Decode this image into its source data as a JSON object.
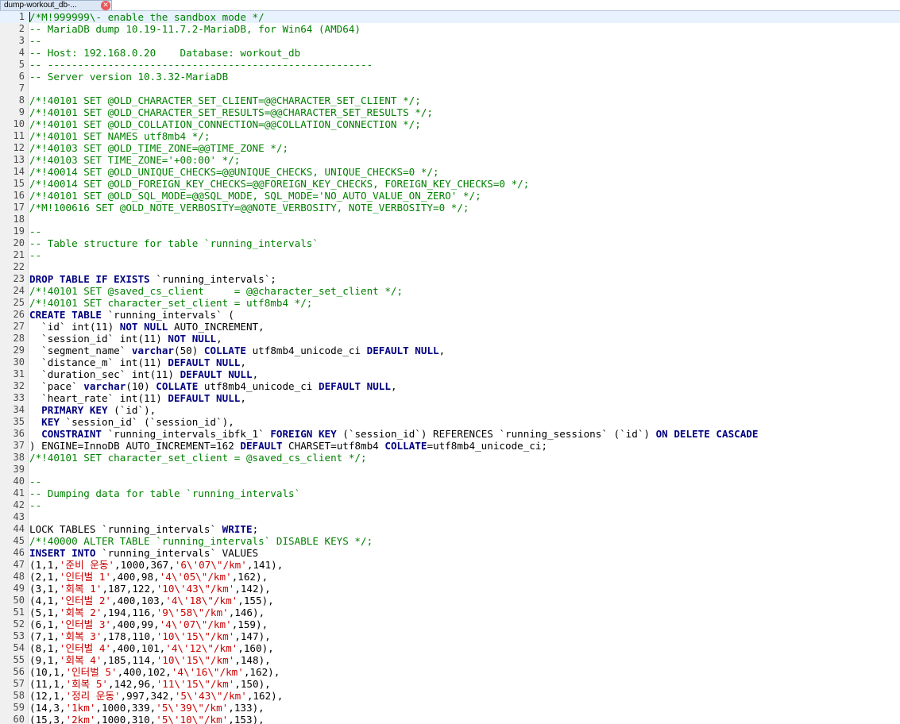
{
  "tab": {
    "title": "dump-workout_db-...",
    "close_icon": "close-icon"
  },
  "colors": {
    "comment": "#008000",
    "keyword": "#000080",
    "string": "#c80000"
  },
  "lines": [
    {
      "n": "1",
      "t": [
        [
          "c",
          "/*M!999999\\- enable the sandbox mode */"
        ]
      ]
    },
    {
      "n": "2",
      "t": [
        [
          "c",
          "-- MariaDB dump 10.19-11.7.2-MariaDB, for Win64 (AMD64)"
        ]
      ]
    },
    {
      "n": "3",
      "t": [
        [
          "c",
          "--"
        ]
      ]
    },
    {
      "n": "4",
      "t": [
        [
          "c",
          "-- Host: 192.168.0.20    Database: workout_db"
        ]
      ]
    },
    {
      "n": "5",
      "t": [
        [
          "c",
          "-- ------------------------------------------------------"
        ]
      ]
    },
    {
      "n": "6",
      "t": [
        [
          "c",
          "-- Server version 10.3.32-MariaDB"
        ]
      ]
    },
    {
      "n": "7",
      "t": []
    },
    {
      "n": "8",
      "t": [
        [
          "c",
          "/*!40101 SET @OLD_CHARACTER_SET_CLIENT=@@CHARACTER_SET_CLIENT */;"
        ]
      ]
    },
    {
      "n": "9",
      "t": [
        [
          "c",
          "/*!40101 SET @OLD_CHARACTER_SET_RESULTS=@@CHARACTER_SET_RESULTS */;"
        ]
      ]
    },
    {
      "n": "10",
      "t": [
        [
          "c",
          "/*!40101 SET @OLD_COLLATION_CONNECTION=@@COLLATION_CONNECTION */;"
        ]
      ]
    },
    {
      "n": "11",
      "t": [
        [
          "c",
          "/*!40101 SET NAMES utf8mb4 */;"
        ]
      ]
    },
    {
      "n": "12",
      "t": [
        [
          "c",
          "/*!40103 SET @OLD_TIME_ZONE=@@TIME_ZONE */;"
        ]
      ]
    },
    {
      "n": "13",
      "t": [
        [
          "c",
          "/*!40103 SET TIME_ZONE='+00:00' */;"
        ]
      ]
    },
    {
      "n": "14",
      "t": [
        [
          "c",
          "/*!40014 SET @OLD_UNIQUE_CHECKS=@@UNIQUE_CHECKS, UNIQUE_CHECKS=0 */;"
        ]
      ]
    },
    {
      "n": "15",
      "t": [
        [
          "c",
          "/*!40014 SET @OLD_FOREIGN_KEY_CHECKS=@@FOREIGN_KEY_CHECKS, FOREIGN_KEY_CHECKS=0 */;"
        ]
      ]
    },
    {
      "n": "16",
      "t": [
        [
          "c",
          "/*!40101 SET @OLD_SQL_MODE=@@SQL_MODE, SQL_MODE='NO_AUTO_VALUE_ON_ZERO' */;"
        ]
      ]
    },
    {
      "n": "17",
      "t": [
        [
          "c",
          "/*M!100616 SET @OLD_NOTE_VERBOSITY=@@NOTE_VERBOSITY, NOTE_VERBOSITY=0 */;"
        ]
      ]
    },
    {
      "n": "18",
      "t": []
    },
    {
      "n": "19",
      "t": [
        [
          "c",
          "--"
        ]
      ]
    },
    {
      "n": "20",
      "t": [
        [
          "c",
          "-- Table structure for table `running_intervals`"
        ]
      ]
    },
    {
      "n": "21",
      "t": [
        [
          "c",
          "--"
        ]
      ]
    },
    {
      "n": "22",
      "t": []
    },
    {
      "n": "23",
      "t": [
        [
          "k",
          "DROP TABLE IF EXISTS"
        ],
        [
          "p",
          " `running_intervals`;"
        ]
      ]
    },
    {
      "n": "24",
      "t": [
        [
          "c",
          "/*!40101 SET @saved_cs_client     = @@character_set_client */;"
        ]
      ]
    },
    {
      "n": "25",
      "t": [
        [
          "c",
          "/*!40101 SET character_set_client = utf8mb4 */;"
        ]
      ]
    },
    {
      "n": "26",
      "t": [
        [
          "k",
          "CREATE TABLE"
        ],
        [
          "p",
          " `running_intervals` ("
        ]
      ]
    },
    {
      "n": "27",
      "t": [
        [
          "p",
          "  `id` int(11) "
        ],
        [
          "k",
          "NOT NULL"
        ],
        [
          "p",
          " AUTO_INCREMENT,"
        ]
      ]
    },
    {
      "n": "28",
      "t": [
        [
          "p",
          "  `session_id` int(11) "
        ],
        [
          "k",
          "NOT NULL"
        ],
        [
          "p",
          ","
        ]
      ]
    },
    {
      "n": "29",
      "t": [
        [
          "p",
          "  `segment_name` "
        ],
        [
          "k",
          "varchar"
        ],
        [
          "p",
          "(50) "
        ],
        [
          "k",
          "COLLATE"
        ],
        [
          "p",
          " utf8mb4_unicode_ci "
        ],
        [
          "k",
          "DEFAULT NULL"
        ],
        [
          "p",
          ","
        ]
      ]
    },
    {
      "n": "30",
      "t": [
        [
          "p",
          "  `distance_m` int(11) "
        ],
        [
          "k",
          "DEFAULT NULL"
        ],
        [
          "p",
          ","
        ]
      ]
    },
    {
      "n": "31",
      "t": [
        [
          "p",
          "  `duration_sec` int(11) "
        ],
        [
          "k",
          "DEFAULT NULL"
        ],
        [
          "p",
          ","
        ]
      ]
    },
    {
      "n": "32",
      "t": [
        [
          "p",
          "  `pace` "
        ],
        [
          "k",
          "varchar"
        ],
        [
          "p",
          "(10) "
        ],
        [
          "k",
          "COLLATE"
        ],
        [
          "p",
          " utf8mb4_unicode_ci "
        ],
        [
          "k",
          "DEFAULT NULL"
        ],
        [
          "p",
          ","
        ]
      ]
    },
    {
      "n": "33",
      "t": [
        [
          "p",
          "  `heart_rate` int(11) "
        ],
        [
          "k",
          "DEFAULT NULL"
        ],
        [
          "p",
          ","
        ]
      ]
    },
    {
      "n": "34",
      "t": [
        [
          "p",
          "  "
        ],
        [
          "k",
          "PRIMARY KEY"
        ],
        [
          "p",
          " (`id`),"
        ]
      ]
    },
    {
      "n": "35",
      "t": [
        [
          "p",
          "  "
        ],
        [
          "k",
          "KEY"
        ],
        [
          "p",
          " `session_id` (`session_id`),"
        ]
      ]
    },
    {
      "n": "36",
      "t": [
        [
          "p",
          "  "
        ],
        [
          "k",
          "CONSTRAINT"
        ],
        [
          "p",
          " `running_intervals_ibfk_1` "
        ],
        [
          "k",
          "FOREIGN KEY"
        ],
        [
          "p",
          " (`session_id`) REFERENCES `running_sessions` (`id`) "
        ],
        [
          "k",
          "ON DELETE CASCADE"
        ]
      ]
    },
    {
      "n": "37",
      "t": [
        [
          "p",
          ") ENGINE=InnoDB AUTO_INCREMENT=162 "
        ],
        [
          "k",
          "DEFAULT"
        ],
        [
          "p",
          " CHARSET=utf8mb4 "
        ],
        [
          "k",
          "COLLATE"
        ],
        [
          "p",
          "=utf8mb4_unicode_ci;"
        ]
      ]
    },
    {
      "n": "38",
      "t": [
        [
          "c",
          "/*!40101 SET character_set_client = @saved_cs_client */;"
        ]
      ]
    },
    {
      "n": "39",
      "t": []
    },
    {
      "n": "40",
      "t": [
        [
          "c",
          "--"
        ]
      ]
    },
    {
      "n": "41",
      "t": [
        [
          "c",
          "-- Dumping data for table `running_intervals`"
        ]
      ]
    },
    {
      "n": "42",
      "t": [
        [
          "c",
          "--"
        ]
      ]
    },
    {
      "n": "43",
      "t": []
    },
    {
      "n": "44",
      "t": [
        [
          "p",
          "LOCK TABLES `running_intervals` "
        ],
        [
          "k",
          "WRITE"
        ],
        [
          "p",
          ";"
        ]
      ]
    },
    {
      "n": "45",
      "t": [
        [
          "c",
          "/*!40000 ALTER TABLE `running_intervals` DISABLE KEYS */;"
        ]
      ]
    },
    {
      "n": "46",
      "t": [
        [
          "k",
          "INSERT INTO"
        ],
        [
          "p",
          " `running_intervals` VALUES"
        ]
      ]
    },
    {
      "n": "47",
      "t": [
        [
          "p",
          "(1,1,"
        ],
        [
          "s",
          "'준비 운동'"
        ],
        [
          "p",
          ",1000,367,"
        ],
        [
          "s",
          "'6\\'07\\\"/km'"
        ],
        [
          "p",
          ",141),"
        ]
      ]
    },
    {
      "n": "48",
      "t": [
        [
          "p",
          "(2,1,"
        ],
        [
          "s",
          "'인터벌 1'"
        ],
        [
          "p",
          ",400,98,"
        ],
        [
          "s",
          "'4\\'05\\\"/km'"
        ],
        [
          "p",
          ",162),"
        ]
      ]
    },
    {
      "n": "49",
      "t": [
        [
          "p",
          "(3,1,"
        ],
        [
          "s",
          "'회복 1'"
        ],
        [
          "p",
          ",187,122,"
        ],
        [
          "s",
          "'10\\'43\\\"/km'"
        ],
        [
          "p",
          ",142),"
        ]
      ]
    },
    {
      "n": "50",
      "t": [
        [
          "p",
          "(4,1,"
        ],
        [
          "s",
          "'인터벌 2'"
        ],
        [
          "p",
          ",400,103,"
        ],
        [
          "s",
          "'4\\'18\\\"/km'"
        ],
        [
          "p",
          ",155),"
        ]
      ]
    },
    {
      "n": "51",
      "t": [
        [
          "p",
          "(5,1,"
        ],
        [
          "s",
          "'회복 2'"
        ],
        [
          "p",
          ",194,116,"
        ],
        [
          "s",
          "'9\\'58\\\"/km'"
        ],
        [
          "p",
          ",146),"
        ]
      ]
    },
    {
      "n": "52",
      "t": [
        [
          "p",
          "(6,1,"
        ],
        [
          "s",
          "'인터벌 3'"
        ],
        [
          "p",
          ",400,99,"
        ],
        [
          "s",
          "'4\\'07\\\"/km'"
        ],
        [
          "p",
          ",159),"
        ]
      ]
    },
    {
      "n": "53",
      "t": [
        [
          "p",
          "(7,1,"
        ],
        [
          "s",
          "'회복 3'"
        ],
        [
          "p",
          ",178,110,"
        ],
        [
          "s",
          "'10\\'15\\\"/km'"
        ],
        [
          "p",
          ",147),"
        ]
      ]
    },
    {
      "n": "54",
      "t": [
        [
          "p",
          "(8,1,"
        ],
        [
          "s",
          "'인터벌 4'"
        ],
        [
          "p",
          ",400,101,"
        ],
        [
          "s",
          "'4\\'12\\\"/km'"
        ],
        [
          "p",
          ",160),"
        ]
      ]
    },
    {
      "n": "55",
      "t": [
        [
          "p",
          "(9,1,"
        ],
        [
          "s",
          "'회복 4'"
        ],
        [
          "p",
          ",185,114,"
        ],
        [
          "s",
          "'10\\'15\\\"/km'"
        ],
        [
          "p",
          ",148),"
        ]
      ]
    },
    {
      "n": "56",
      "t": [
        [
          "p",
          "(10,1,"
        ],
        [
          "s",
          "'인터벌 5'"
        ],
        [
          "p",
          ",400,102,"
        ],
        [
          "s",
          "'4\\'16\\\"/km'"
        ],
        [
          "p",
          ",162),"
        ]
      ]
    },
    {
      "n": "57",
      "t": [
        [
          "p",
          "(11,1,"
        ],
        [
          "s",
          "'회복 5'"
        ],
        [
          "p",
          ",142,96,"
        ],
        [
          "s",
          "'11\\'15\\\"/km'"
        ],
        [
          "p",
          ",150),"
        ]
      ]
    },
    {
      "n": "58",
      "t": [
        [
          "p",
          "(12,1,"
        ],
        [
          "s",
          "'정리 운동'"
        ],
        [
          "p",
          ",997,342,"
        ],
        [
          "s",
          "'5\\'43\\\"/km'"
        ],
        [
          "p",
          ",162),"
        ]
      ]
    },
    {
      "n": "59",
      "t": [
        [
          "p",
          "(14,3,"
        ],
        [
          "s",
          "'1km'"
        ],
        [
          "p",
          ",1000,339,"
        ],
        [
          "s",
          "'5\\'39\\\"/km'"
        ],
        [
          "p",
          ",133),"
        ]
      ]
    },
    {
      "n": "60",
      "t": [
        [
          "p",
          "(15,3,"
        ],
        [
          "s",
          "'2km'"
        ],
        [
          "p",
          ",1000,310,"
        ],
        [
          "s",
          "'5\\'10\\\"/km'"
        ],
        [
          "p",
          ",153),"
        ]
      ]
    }
  ]
}
